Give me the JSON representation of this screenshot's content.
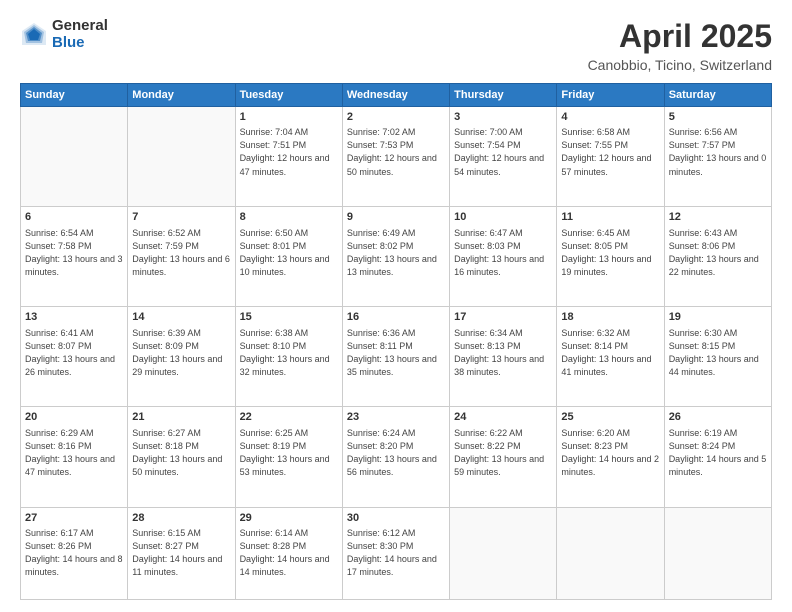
{
  "logo": {
    "general": "General",
    "blue": "Blue"
  },
  "title": "April 2025",
  "subtitle": "Canobbio, Ticino, Switzerland",
  "days_header": [
    "Sunday",
    "Monday",
    "Tuesday",
    "Wednesday",
    "Thursday",
    "Friday",
    "Saturday"
  ],
  "weeks": [
    [
      {
        "day": "",
        "info": ""
      },
      {
        "day": "",
        "info": ""
      },
      {
        "day": "1",
        "info": "Sunrise: 7:04 AM\nSunset: 7:51 PM\nDaylight: 12 hours and 47 minutes."
      },
      {
        "day": "2",
        "info": "Sunrise: 7:02 AM\nSunset: 7:53 PM\nDaylight: 12 hours and 50 minutes."
      },
      {
        "day": "3",
        "info": "Sunrise: 7:00 AM\nSunset: 7:54 PM\nDaylight: 12 hours and 54 minutes."
      },
      {
        "day": "4",
        "info": "Sunrise: 6:58 AM\nSunset: 7:55 PM\nDaylight: 12 hours and 57 minutes."
      },
      {
        "day": "5",
        "info": "Sunrise: 6:56 AM\nSunset: 7:57 PM\nDaylight: 13 hours and 0 minutes."
      }
    ],
    [
      {
        "day": "6",
        "info": "Sunrise: 6:54 AM\nSunset: 7:58 PM\nDaylight: 13 hours and 3 minutes."
      },
      {
        "day": "7",
        "info": "Sunrise: 6:52 AM\nSunset: 7:59 PM\nDaylight: 13 hours and 6 minutes."
      },
      {
        "day": "8",
        "info": "Sunrise: 6:50 AM\nSunset: 8:01 PM\nDaylight: 13 hours and 10 minutes."
      },
      {
        "day": "9",
        "info": "Sunrise: 6:49 AM\nSunset: 8:02 PM\nDaylight: 13 hours and 13 minutes."
      },
      {
        "day": "10",
        "info": "Sunrise: 6:47 AM\nSunset: 8:03 PM\nDaylight: 13 hours and 16 minutes."
      },
      {
        "day": "11",
        "info": "Sunrise: 6:45 AM\nSunset: 8:05 PM\nDaylight: 13 hours and 19 minutes."
      },
      {
        "day": "12",
        "info": "Sunrise: 6:43 AM\nSunset: 8:06 PM\nDaylight: 13 hours and 22 minutes."
      }
    ],
    [
      {
        "day": "13",
        "info": "Sunrise: 6:41 AM\nSunset: 8:07 PM\nDaylight: 13 hours and 26 minutes."
      },
      {
        "day": "14",
        "info": "Sunrise: 6:39 AM\nSunset: 8:09 PM\nDaylight: 13 hours and 29 minutes."
      },
      {
        "day": "15",
        "info": "Sunrise: 6:38 AM\nSunset: 8:10 PM\nDaylight: 13 hours and 32 minutes."
      },
      {
        "day": "16",
        "info": "Sunrise: 6:36 AM\nSunset: 8:11 PM\nDaylight: 13 hours and 35 minutes."
      },
      {
        "day": "17",
        "info": "Sunrise: 6:34 AM\nSunset: 8:13 PM\nDaylight: 13 hours and 38 minutes."
      },
      {
        "day": "18",
        "info": "Sunrise: 6:32 AM\nSunset: 8:14 PM\nDaylight: 13 hours and 41 minutes."
      },
      {
        "day": "19",
        "info": "Sunrise: 6:30 AM\nSunset: 8:15 PM\nDaylight: 13 hours and 44 minutes."
      }
    ],
    [
      {
        "day": "20",
        "info": "Sunrise: 6:29 AM\nSunset: 8:16 PM\nDaylight: 13 hours and 47 minutes."
      },
      {
        "day": "21",
        "info": "Sunrise: 6:27 AM\nSunset: 8:18 PM\nDaylight: 13 hours and 50 minutes."
      },
      {
        "day": "22",
        "info": "Sunrise: 6:25 AM\nSunset: 8:19 PM\nDaylight: 13 hours and 53 minutes."
      },
      {
        "day": "23",
        "info": "Sunrise: 6:24 AM\nSunset: 8:20 PM\nDaylight: 13 hours and 56 minutes."
      },
      {
        "day": "24",
        "info": "Sunrise: 6:22 AM\nSunset: 8:22 PM\nDaylight: 13 hours and 59 minutes."
      },
      {
        "day": "25",
        "info": "Sunrise: 6:20 AM\nSunset: 8:23 PM\nDaylight: 14 hours and 2 minutes."
      },
      {
        "day": "26",
        "info": "Sunrise: 6:19 AM\nSunset: 8:24 PM\nDaylight: 14 hours and 5 minutes."
      }
    ],
    [
      {
        "day": "27",
        "info": "Sunrise: 6:17 AM\nSunset: 8:26 PM\nDaylight: 14 hours and 8 minutes."
      },
      {
        "day": "28",
        "info": "Sunrise: 6:15 AM\nSunset: 8:27 PM\nDaylight: 14 hours and 11 minutes."
      },
      {
        "day": "29",
        "info": "Sunrise: 6:14 AM\nSunset: 8:28 PM\nDaylight: 14 hours and 14 minutes."
      },
      {
        "day": "30",
        "info": "Sunrise: 6:12 AM\nSunset: 8:30 PM\nDaylight: 14 hours and 17 minutes."
      },
      {
        "day": "",
        "info": ""
      },
      {
        "day": "",
        "info": ""
      },
      {
        "day": "",
        "info": ""
      }
    ]
  ]
}
